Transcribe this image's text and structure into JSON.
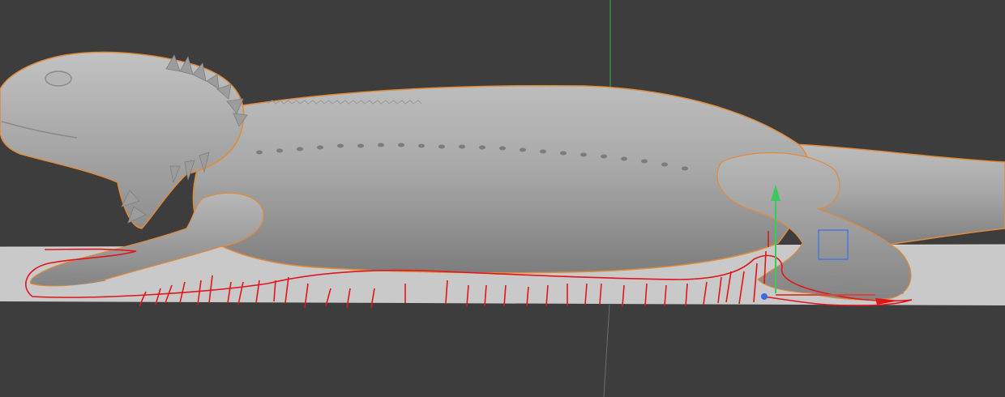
{
  "viewport": {
    "background": "#3d3d3d",
    "ground_plane_color": "#c8c8c8",
    "model_color": "#a9a9a9",
    "selection_outline_color": "#e08a3a",
    "annotation_color": "#e0161b",
    "axis_colors": {
      "x": "#d24b3a",
      "y": "#3cc85a",
      "z": "#3a6be0"
    }
  },
  "scene": {
    "object": "lizard-sculpt-mesh",
    "gizmo": "move-gizmo",
    "annotation": "red-support-sketch"
  }
}
